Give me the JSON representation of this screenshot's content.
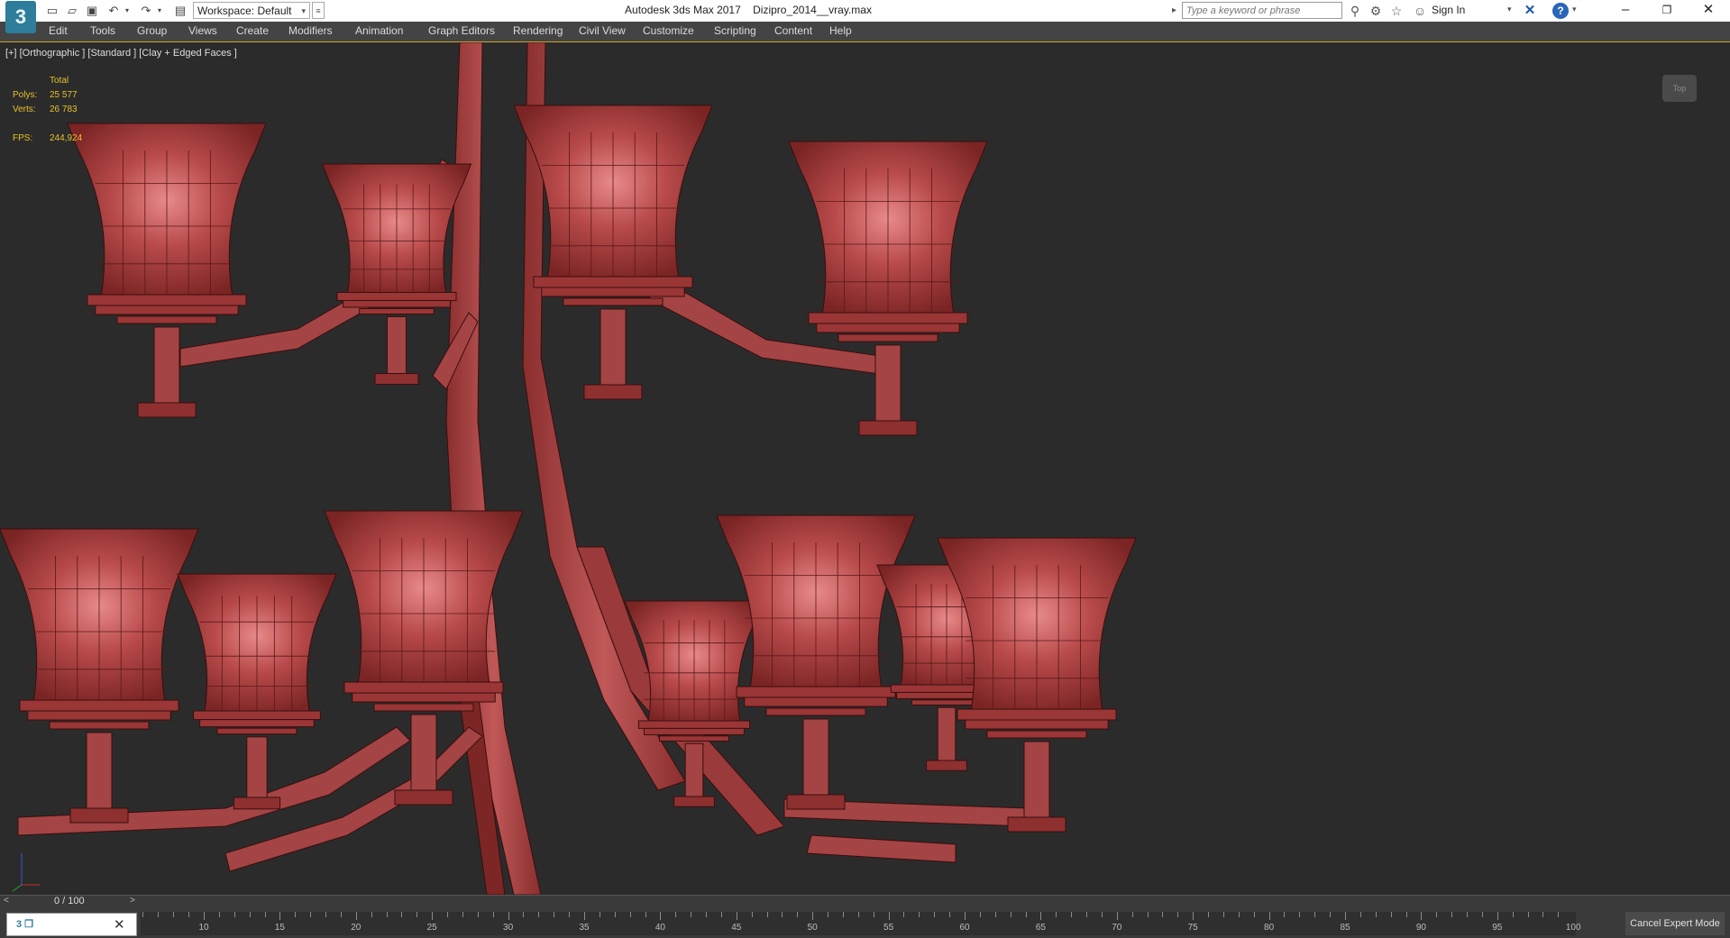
{
  "titlebar": {
    "app_title": "Autodesk 3ds Max 2017    Dizipro_2014__vray.max",
    "logo_text": "3",
    "workspace_label": "Workspace: Default",
    "search_placeholder": "Type a keyword or phrase",
    "sign_in": "Sign In",
    "icons": [
      "new-file-icon",
      "open-file-icon",
      "save-icon",
      "undo-icon",
      "redo-icon",
      "project-icon",
      "binoculars-icon",
      "exchange-icon",
      "favorites-star-icon",
      "user-icon",
      "x-exchange-icon",
      "help-icon"
    ]
  },
  "menu": [
    "Edit",
    "Tools",
    "Group",
    "Views",
    "Create",
    "Modifiers",
    "Animation",
    "Graph Editors",
    "Rendering",
    "Civil View",
    "Customize",
    "Scripting",
    "Content",
    "Help"
  ],
  "viewport": {
    "label": "[+] [Orthographic ] [Standard ] [Clay + Edged Faces ]",
    "stats": {
      "header": "Total",
      "polys_label": "Polys:",
      "polys_value": "25 577",
      "verts_label": "Verts:",
      "verts_value": "26 783",
      "fps_label": "FPS:",
      "fps_value": "244,924"
    },
    "viewcube_label": "Top"
  },
  "timeline": {
    "frame_counter": "0 / 100",
    "prev_label": "<",
    "next_label": ">",
    "ticks": [
      "10",
      "15",
      "20",
      "25",
      "30",
      "35",
      "40",
      "45",
      "50",
      "55",
      "60",
      "65",
      "70",
      "75",
      "80",
      "85",
      "90",
      "95",
      "100"
    ]
  },
  "bottom": {
    "cancel_expert": "Cancel Expert Mode"
  },
  "colors": {
    "model_red": "#a63c3c",
    "accent_yellow": "#e6c229",
    "viewport_bg": "#2b2b2b",
    "menu_bg": "#444444"
  }
}
